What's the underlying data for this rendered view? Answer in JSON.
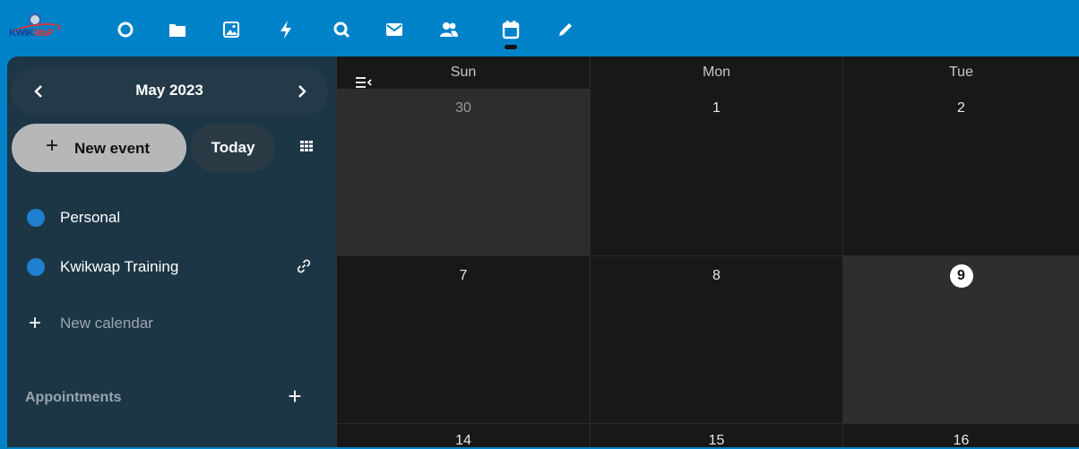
{
  "app": {
    "logo_text_a": "KWIK",
    "logo_text_b": "WaP"
  },
  "nav": {
    "items": [
      {
        "name": "dashboard-icon"
      },
      {
        "name": "files-icon"
      },
      {
        "name": "photos-icon"
      },
      {
        "name": "activity-icon"
      },
      {
        "name": "search-icon"
      },
      {
        "name": "mail-icon"
      },
      {
        "name": "contacts-icon"
      },
      {
        "name": "calendar-icon",
        "active": true
      },
      {
        "name": "notes-icon"
      }
    ],
    "accent": "#0082c9"
  },
  "sidebar": {
    "month_label": "May 2023",
    "prev_label": "‹",
    "next_label": "›",
    "new_event_plus": "+",
    "new_event_label": "New event",
    "today_label": "Today",
    "calendars": [
      {
        "name": "Personal",
        "color": "#1f7fd0",
        "shared": false
      },
      {
        "name": "Kwikwap Training",
        "color": "#1f7fd0",
        "shared": true
      }
    ],
    "new_calendar_plus": "+",
    "new_calendar_label": "New calendar",
    "appointments_label": "Appointments",
    "appointments_add": "+"
  },
  "calendar": {
    "weekdays": [
      "Sun",
      "Mon",
      "Tue"
    ],
    "weeks": [
      [
        "30",
        "1",
        "2"
      ],
      [
        "7",
        "8",
        "9"
      ],
      [
        "14",
        "15",
        "16"
      ]
    ],
    "other_month_day": "30",
    "today": "9"
  }
}
